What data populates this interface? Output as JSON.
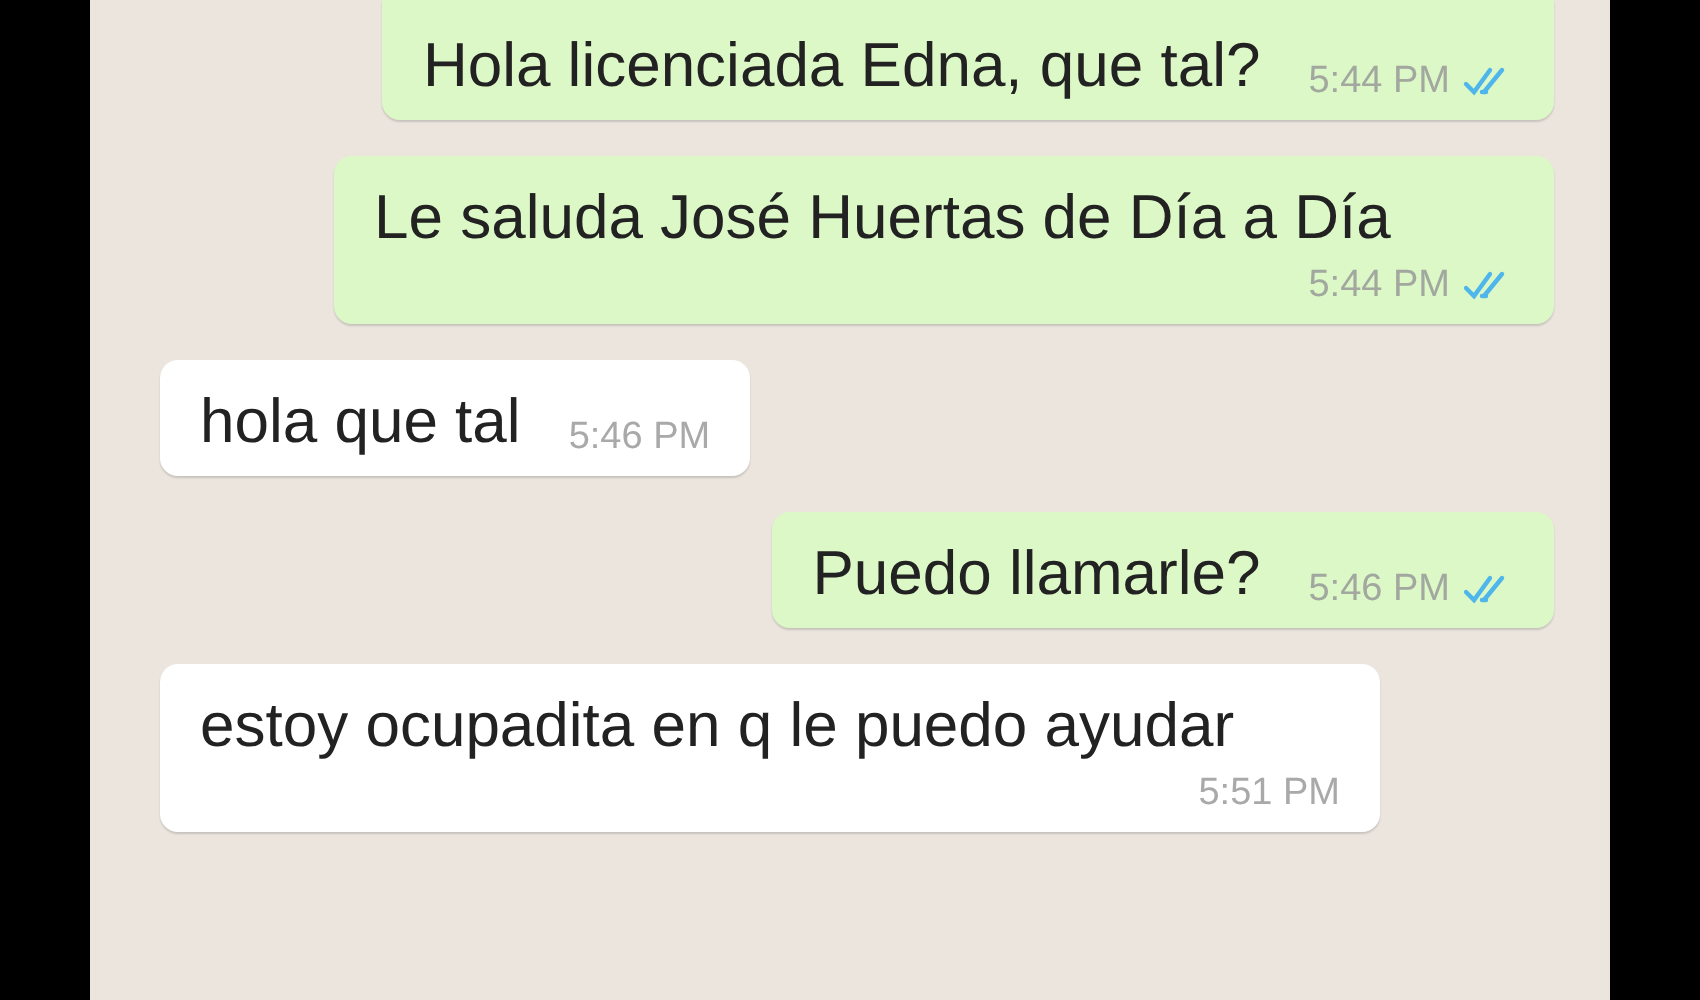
{
  "messages": [
    {
      "outgoing": true,
      "text": "Hola licenciada Edna, que tal?",
      "time": "5:44 PM",
      "read": true
    },
    {
      "outgoing": true,
      "text": "Le saluda José Huertas de Día a Día",
      "time": "5:44 PM",
      "read": true
    },
    {
      "outgoing": false,
      "text": "hola que tal",
      "time": "5:46 PM"
    },
    {
      "outgoing": true,
      "text": "Puedo llamarle?",
      "time": "5:46 PM",
      "read": true
    },
    {
      "outgoing": false,
      "text": "estoy ocupadita en q le puedo ayudar",
      "time": "5:51 PM"
    }
  ]
}
